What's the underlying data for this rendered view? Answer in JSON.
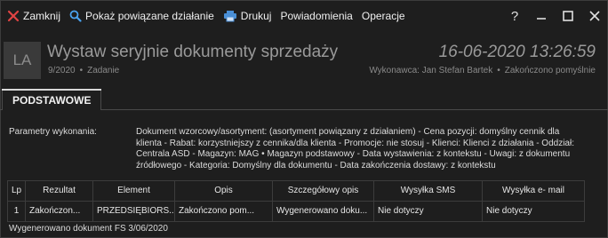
{
  "toolbar": {
    "close_label": "Zamknij",
    "show_related_label": "Pokaż powiązane działanie",
    "print_label": "Drukuj",
    "notifications_label": "Powiadomienia",
    "operations_label": "Operacje"
  },
  "window": {
    "help_label": "?"
  },
  "header": {
    "avatar": "LA",
    "title": "Wystaw seryjnie dokumenty sprzedaży",
    "number": "9/2020",
    "type": "Zadanie",
    "datetime": "16-06-2020 13:26:59",
    "executor": "Wykonawca: Jan Stefan Bartek",
    "status": "Zakończono pomyślnie"
  },
  "tabs": [
    {
      "label": "PODSTAWOWE"
    }
  ],
  "params": {
    "label": "Parametry wykonania:",
    "text": "Dokument wzorcowy/asortyment: (asortyment powiązany z działaniem) - Cena pozycji: domyślny cennik dla klienta - Rabat: korzystniejszy z cennika/dla klienta - Promocje: nie stosuj - Klienci: Klienci z działania - Oddział: Centrala ASD - Magazyn: MAG • Magazyn podstawowy - Data wystawienia: z kontekstu - Uwagi: z dokumentu źródłowego - Kategoria: Domyślny dla dokumentu - Data zakończenia dostawy: z kontekstu"
  },
  "table": {
    "columns": [
      "Lp",
      "Rezultat",
      "Element",
      "Opis",
      "Szczegółowy opis",
      "Wysyłka SMS",
      "Wysyłka e- mail"
    ],
    "rows": [
      [
        "1",
        "Zakończon...",
        "PRZEDSIĘBIORS...",
        "Zakończono pom...",
        "Wygenerowano doku...",
        "Nie dotyczy",
        "Nie dotyczy"
      ]
    ]
  },
  "status_text": "Wygenerowano dokument FS 3/06/2020",
  "icons": {
    "close": "close-icon",
    "search": "search-icon",
    "print": "printer-icon",
    "minimize": "minimize-icon",
    "maximize": "maximize-icon",
    "window_close": "window-close-icon"
  },
  "colors": {
    "background": "#1e1e1e",
    "close_icon": "#e04343",
    "search_icon": "#4aa3f0",
    "print_icon": "#4a8fd6"
  }
}
